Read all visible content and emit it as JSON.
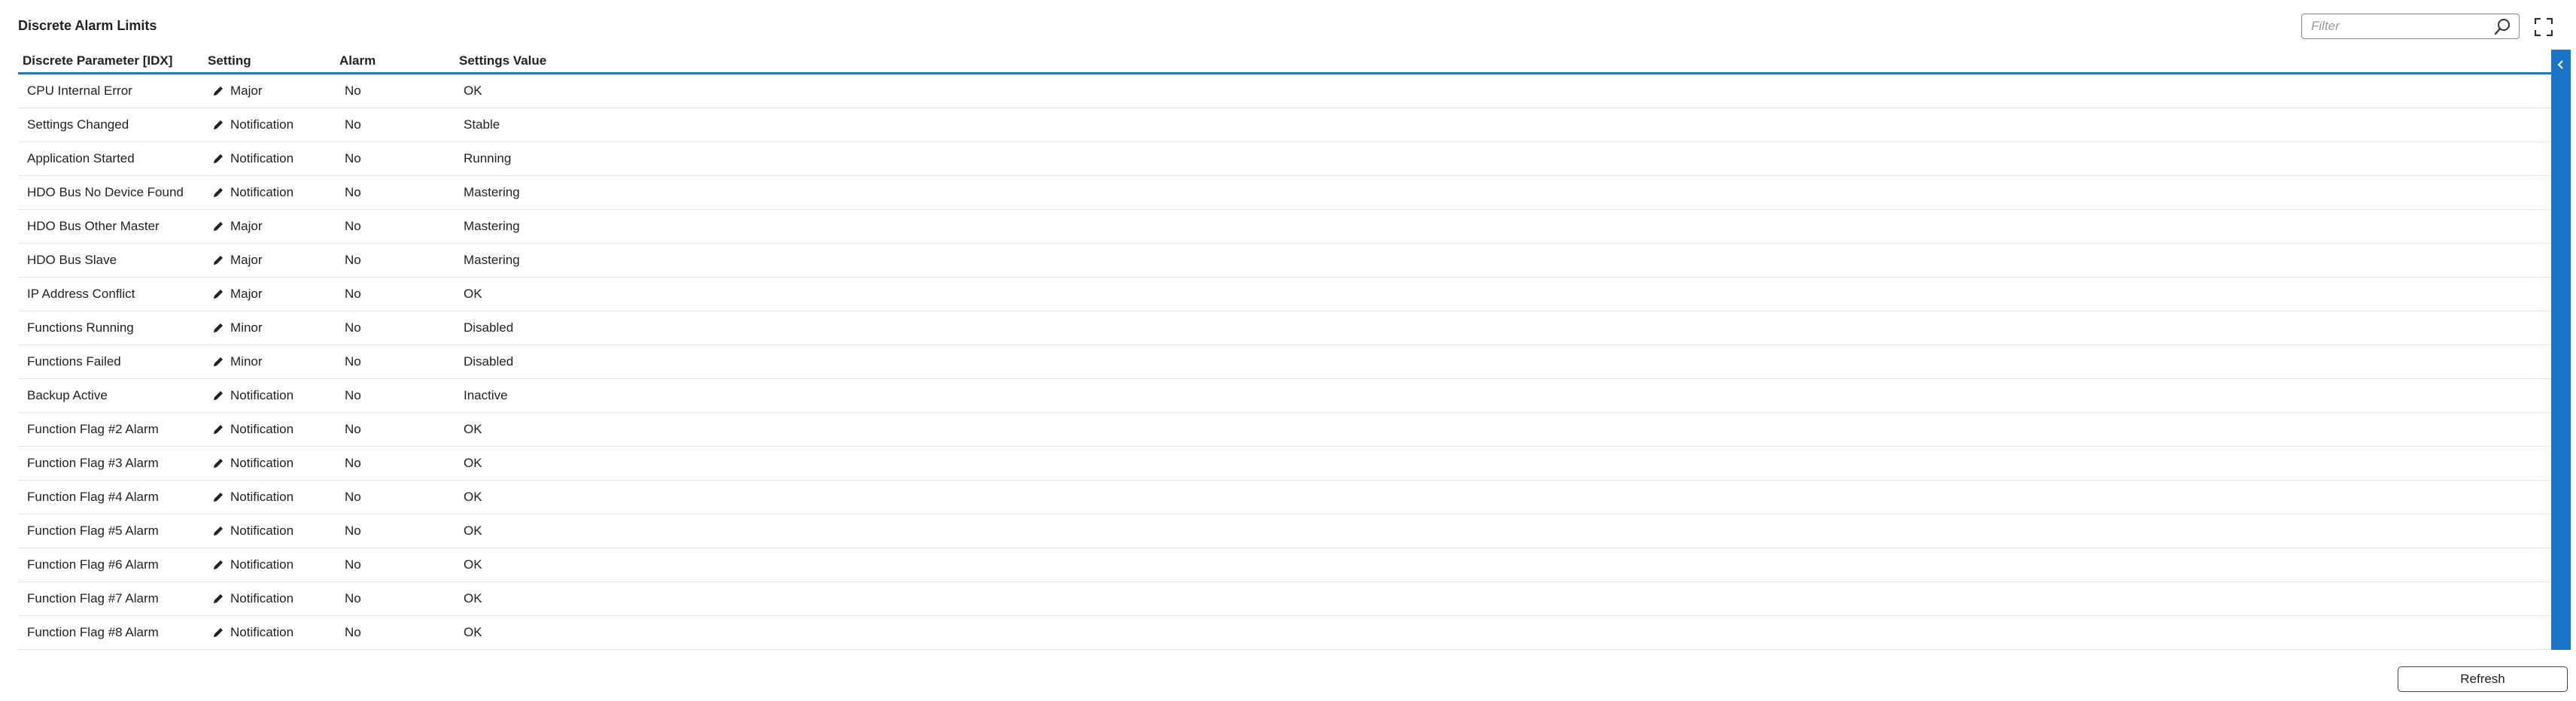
{
  "title": "Discrete Alarm Limits",
  "filter": {
    "placeholder": "Filter",
    "value": ""
  },
  "columns": {
    "param": "Discrete Parameter [IDX]",
    "setting": "Setting",
    "alarm": "Alarm",
    "value": "Settings Value"
  },
  "rows": [
    {
      "param": "CPU Internal Error",
      "setting": "Major",
      "alarm": "No",
      "value": "OK"
    },
    {
      "param": "Settings Changed",
      "setting": "Notification",
      "alarm": "No",
      "value": "Stable"
    },
    {
      "param": "Application Started",
      "setting": "Notification",
      "alarm": "No",
      "value": "Running"
    },
    {
      "param": "HDO Bus No Device Found",
      "setting": "Notification",
      "alarm": "No",
      "value": "Mastering"
    },
    {
      "param": "HDO Bus Other Master",
      "setting": "Major",
      "alarm": "No",
      "value": "Mastering"
    },
    {
      "param": "HDO Bus Slave",
      "setting": "Major",
      "alarm": "No",
      "value": "Mastering"
    },
    {
      "param": "IP Address Conflict",
      "setting": "Major",
      "alarm": "No",
      "value": "OK"
    },
    {
      "param": "Functions Running",
      "setting": "Minor",
      "alarm": "No",
      "value": "Disabled"
    },
    {
      "param": "Functions Failed",
      "setting": "Minor",
      "alarm": "No",
      "value": "Disabled"
    },
    {
      "param": "Backup Active",
      "setting": "Notification",
      "alarm": "No",
      "value": "Inactive"
    },
    {
      "param": "Function Flag #2 Alarm",
      "setting": "Notification",
      "alarm": "No",
      "value": "OK"
    },
    {
      "param": "Function Flag #3 Alarm",
      "setting": "Notification",
      "alarm": "No",
      "value": "OK"
    },
    {
      "param": "Function Flag #4 Alarm",
      "setting": "Notification",
      "alarm": "No",
      "value": "OK"
    },
    {
      "param": "Function Flag #5 Alarm",
      "setting": "Notification",
      "alarm": "No",
      "value": "OK"
    },
    {
      "param": "Function Flag #6 Alarm",
      "setting": "Notification",
      "alarm": "No",
      "value": "OK"
    },
    {
      "param": "Function Flag #7 Alarm",
      "setting": "Notification",
      "alarm": "No",
      "value": "OK"
    },
    {
      "param": "Function Flag #8 Alarm",
      "setting": "Notification",
      "alarm": "No",
      "value": "OK"
    }
  ],
  "icons": {
    "search": "search-icon",
    "fullscreen": "fullscreen-icon",
    "edit": "pencil-icon",
    "collapse": "chevron-left-icon"
  },
  "colors": {
    "accent": "#1a74c7"
  },
  "buttons": {
    "refresh": "Refresh"
  }
}
